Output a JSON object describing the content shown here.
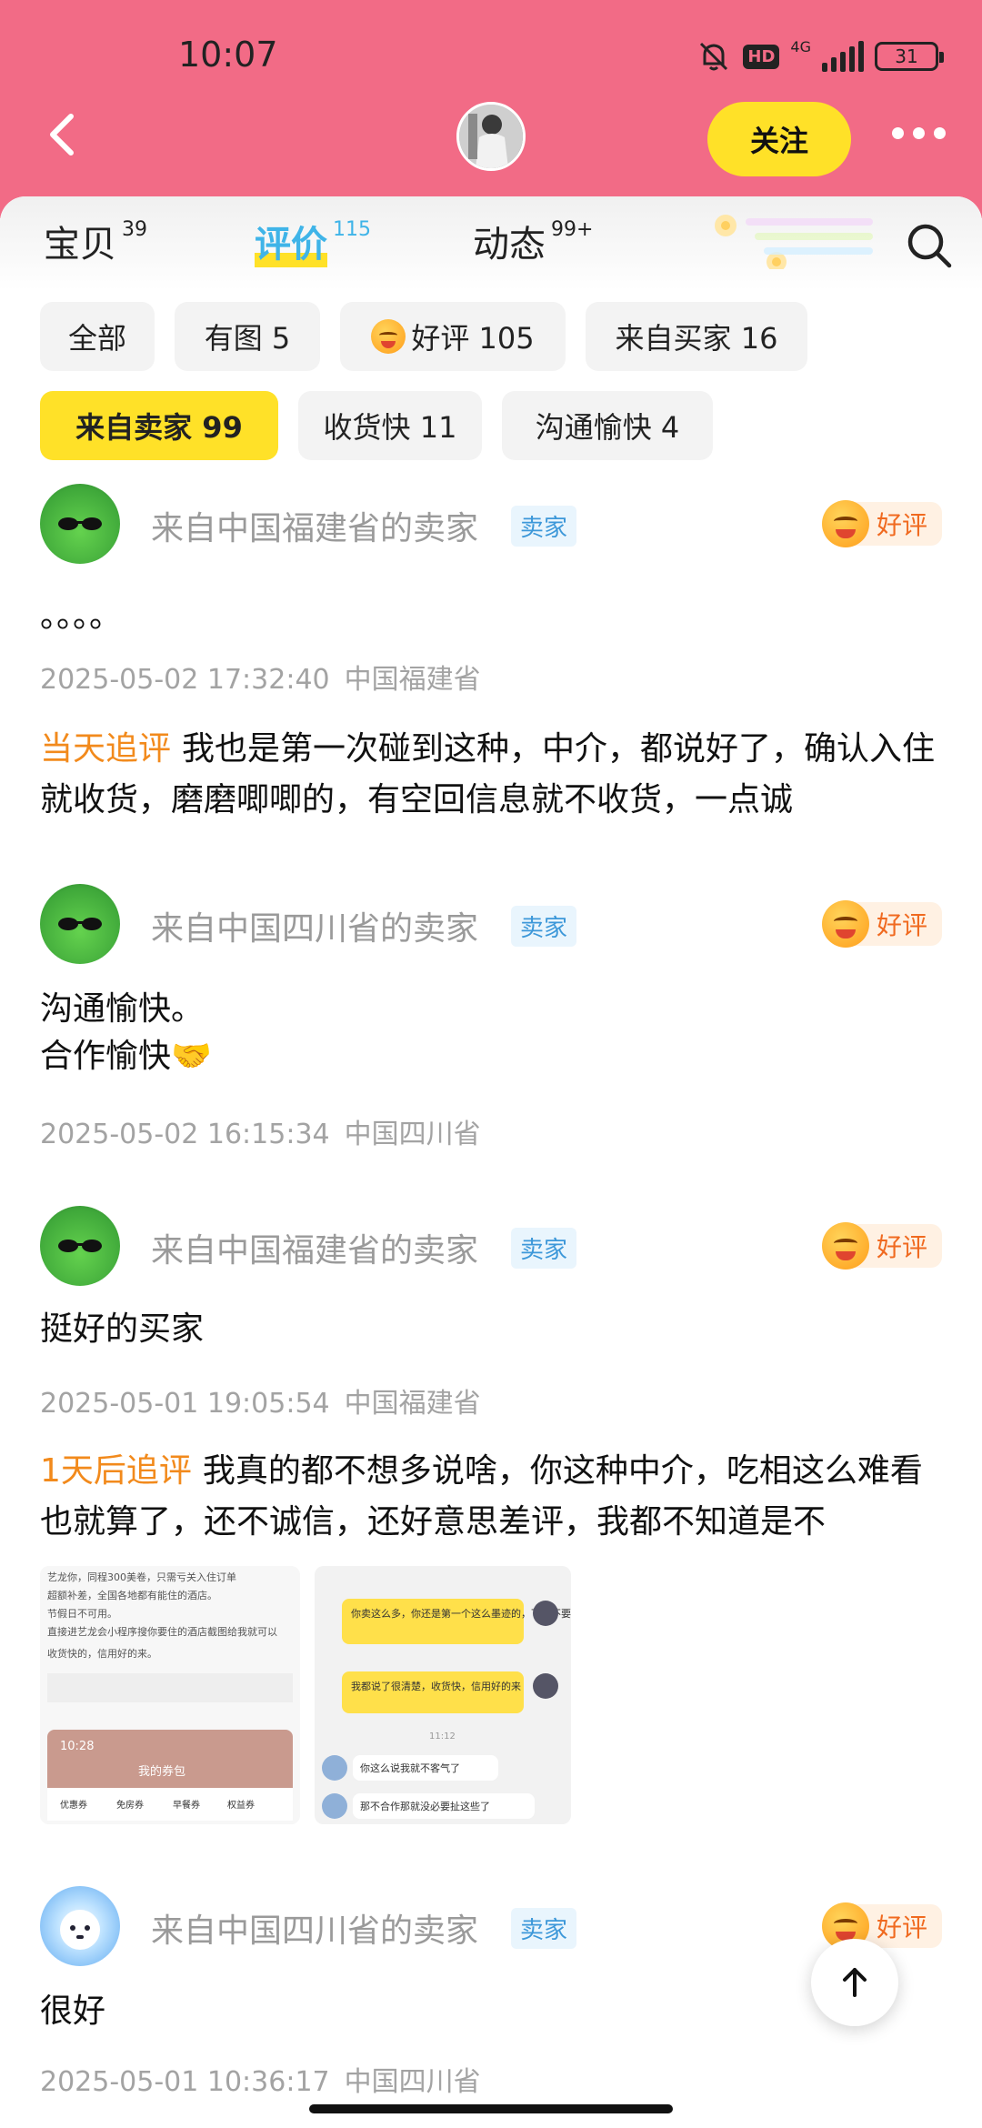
{
  "status_bar": {
    "time": "10:07",
    "network": "4G",
    "hd": "HD",
    "battery": "31"
  },
  "header": {
    "follow_label": "关注"
  },
  "tabs": [
    {
      "label": "宝贝",
      "count": "39"
    },
    {
      "label": "评价",
      "count": "115",
      "active": true
    },
    {
      "label": "动态",
      "count": "99+"
    }
  ],
  "filters": {
    "all": "全部",
    "with_image": "有图 5",
    "positive": "好评 105",
    "from_buyer": "来自买家 16",
    "from_seller": "来自卖家 99",
    "fast_receipt": "收货快 11",
    "pleasant": "沟通愉快 4"
  },
  "reviews": [
    {
      "seller": "来自中国福建省的卖家",
      "tag": "卖家",
      "badge": "好评",
      "content": "。。。。",
      "time": "2025-05-02 17:32:40",
      "location": "中国福建省",
      "followup_label": "当天追评",
      "followup_text": "我也是第一次碰到这种，中介，都说好了，确认入住就收货，磨磨唧唧的，有空回信息就不收货，一点诚"
    },
    {
      "seller": "来自中国四川省的卖家",
      "tag": "卖家",
      "badge": "好评",
      "content": "沟通愉快。\n合作愉快🤝",
      "time": "2025-05-02 16:15:34",
      "location": "中国四川省"
    },
    {
      "seller": "来自中国福建省的卖家",
      "tag": "卖家",
      "badge": "好评",
      "content": "挺好的买家",
      "time": "2025-05-01 19:05:54",
      "location": "中国福建省",
      "followup_label": "1天后追评",
      "followup_text": "我真的都不想多说啥，你这种中介，吃相这么难看也就算了，还不诚信，还好意思差评，我都不知道是不"
    },
    {
      "seller": "来自中国四川省的卖家",
      "tag": "卖家",
      "badge": "好评",
      "content": "很好",
      "time": "2025-05-01 10:36:17",
      "location": "中国四川省"
    }
  ],
  "thumb1": {
    "lines": [
      "艺龙你，同程300美卷，只需亏关入住订单",
      "超额补差，全国各地都有能住的酒店。",
      "节假日不可用。",
      "直接进艺龙会小程序搜你要住的酒店截图给我就可以",
      "收货快的，信用好的来。"
    ],
    "phone_time": "10:28",
    "phone_title": "我的券包",
    "phone_tabs": [
      "优惠券",
      "免房券",
      "早餐券",
      "权益券"
    ]
  },
  "thumb2": {
    "bubble1": "你卖这么多，你还是第一个这么墨迹的，下次不要找我合作",
    "bubble2": "我都说了很清楚，收货快，信用好的来",
    "time": "11:12",
    "reply1": "你这么说我就不客气了",
    "reply2": "那不合作那就没必要扯这些了"
  }
}
